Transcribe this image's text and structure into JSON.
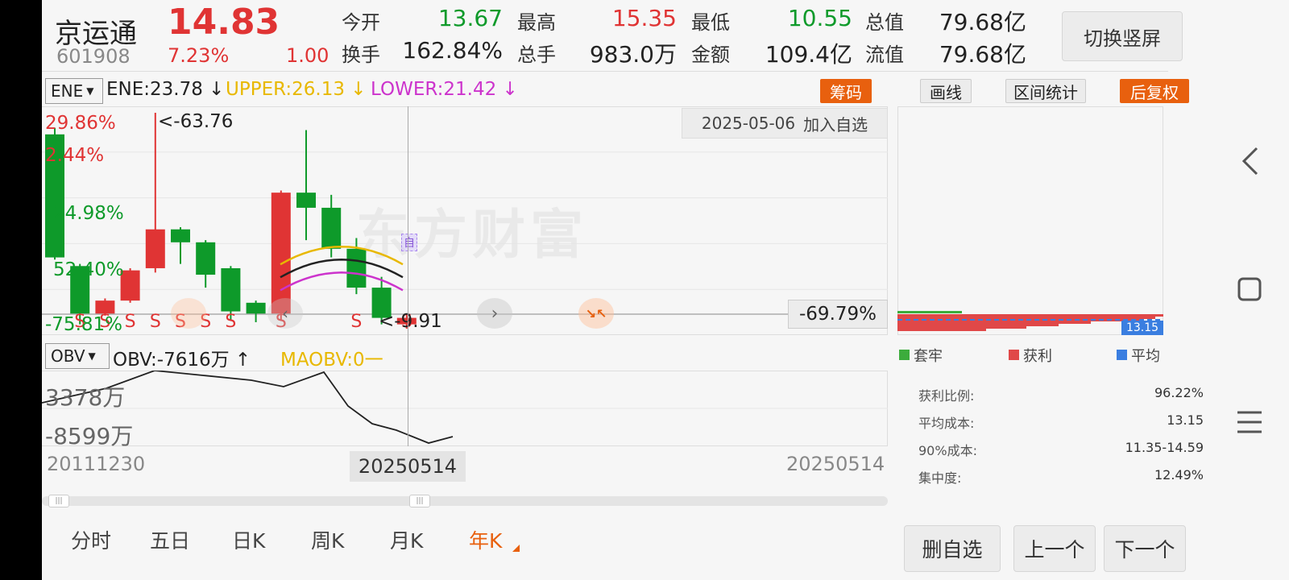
{
  "header": {
    "name": "京运通",
    "price": "14.83",
    "code": "601908",
    "change_pct": "7.23%",
    "change": "1.00",
    "fields": [
      {
        "label": "今开",
        "value": "13.67",
        "tone": "green"
      },
      {
        "label": "最高",
        "value": "15.35",
        "tone": "red"
      },
      {
        "label": "最低",
        "value": "10.55",
        "tone": "green"
      },
      {
        "label": "总值",
        "value": "79.68亿",
        "tone": "dark"
      },
      {
        "label": "换手",
        "value": "162.84%",
        "tone": "dark"
      },
      {
        "label": "总手",
        "value": "983.0万",
        "tone": "dark"
      },
      {
        "label": "金额",
        "value": "109.4亿",
        "tone": "dark"
      },
      {
        "label": "流值",
        "value": "79.68亿",
        "tone": "dark"
      }
    ],
    "switch_button": "切换竖屏"
  },
  "indicator_bar": {
    "selector": "ENE",
    "ene": "ENE:23.78 ↓",
    "upper": "UPPER:26.13 ↓",
    "lower": "LOWER:21.42 ↓",
    "chips_button": "筹码",
    "draw_button": "画线",
    "range_stats_button": "区间统计",
    "adjust_button": "后复权"
  },
  "main_chart": {
    "y_labels": [
      "29.86%",
      "2.44%",
      "24.98%",
      "52.40%",
      "-75.81%"
    ],
    "max_marker": "<-63.76",
    "min_marker": "<-9.91",
    "date_tooltip": "2025-05-06",
    "add_watch_inline": "加入自选",
    "crosshair_value": "-69.79%",
    "watermark": "东方财富",
    "self_select_marker": "自",
    "signal_letter": "S",
    "colors": {
      "up": "#e03434",
      "down": "#0e9a2a",
      "upper": "#e8b800",
      "lower": "#cc33cc",
      "mid": "#222222"
    }
  },
  "obv_bar": {
    "selector": "OBV",
    "obv": "OBV:-7616万 ↑",
    "maobv": "MAOBV:0一"
  },
  "obv_chart": {
    "y_labels": [
      "3378万",
      "-8599万"
    ]
  },
  "time_axis": {
    "start": "20111230",
    "cursor": "20250514",
    "end": "20250514"
  },
  "chip_panel": {
    "avg_tag": "13.15",
    "legend": [
      {
        "label": "套牢",
        "color": "#3cac3c"
      },
      {
        "label": "获利",
        "color": "#e04848"
      },
      {
        "label": "平均",
        "color": "#3a7ee0"
      }
    ],
    "stats": [
      {
        "label": "获利比例:",
        "value": "96.22%"
      },
      {
        "label": "平均成本:",
        "value": "13.15"
      },
      {
        "label": "90%成本:",
        "value": "11.35-14.59"
      },
      {
        "label": "集中度:",
        "value": "12.49%"
      }
    ]
  },
  "period_tabs": [
    "分时",
    "五日",
    "日K",
    "周K",
    "月K",
    "年K"
  ],
  "active_tab": "年K",
  "bottom_buttons": {
    "remove_watch": "删自选",
    "prev": "上一个",
    "next": "下一个"
  },
  "chart_data": {
    "type": "candlestick",
    "note_series": [
      "ENE",
      "UPPER",
      "LOWER"
    ],
    "candles": [
      {
        "open": 0.9,
        "close": 0.33,
        "high": 0.93,
        "low": 0.32,
        "dir": "down"
      },
      {
        "open": 0.29,
        "close": 0.07,
        "high": 0.3,
        "low": 0.02,
        "dir": "down"
      },
      {
        "open": 0.07,
        "close": 0.13,
        "high": 0.14,
        "low": 0.06,
        "dir": "up"
      },
      {
        "open": 0.13,
        "close": 0.27,
        "high": 0.28,
        "low": 0.12,
        "dir": "up"
      },
      {
        "open": 0.28,
        "close": 0.46,
        "high": 1.0,
        "low": 0.26,
        "dir": "up"
      },
      {
        "open": 0.46,
        "close": 0.4,
        "high": 0.47,
        "low": 0.3,
        "dir": "down"
      },
      {
        "open": 0.4,
        "close": 0.25,
        "high": 0.41,
        "low": 0.19,
        "dir": "down"
      },
      {
        "open": 0.28,
        "close": 0.08,
        "high": 0.29,
        "low": 0.04,
        "dir": "down"
      },
      {
        "open": 0.12,
        "close": 0.07,
        "high": 0.13,
        "low": 0.03,
        "dir": "down"
      },
      {
        "open": 0.07,
        "close": 0.63,
        "high": 0.64,
        "low": 0.04,
        "dir": "up"
      },
      {
        "open": 0.63,
        "close": 0.56,
        "high": 0.92,
        "low": 0.41,
        "dir": "down"
      },
      {
        "open": 0.56,
        "close": 0.37,
        "high": 0.62,
        "low": 0.33,
        "dir": "down"
      },
      {
        "open": 0.37,
        "close": 0.19,
        "high": 0.42,
        "low": 0.16,
        "dir": "down"
      },
      {
        "open": 0.19,
        "close": 0.05,
        "high": 0.24,
        "low": 0.02,
        "dir": "down"
      },
      {
        "open": 0.05,
        "close": 0.02,
        "high": 0.07,
        "low": 0.0,
        "dir": "up"
      }
    ],
    "signals": [
      1,
      2,
      3,
      4,
      5,
      6,
      7,
      9,
      12,
      14
    ]
  }
}
